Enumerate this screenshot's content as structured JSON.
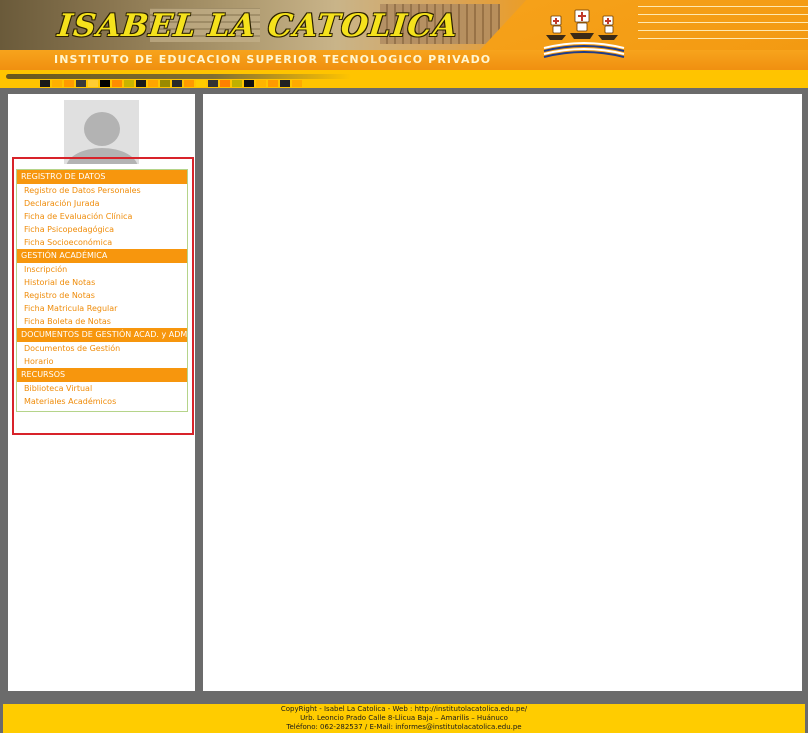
{
  "header": {
    "title": "ISABEL LA CATOLICA",
    "subtitle": "INSTITUTO DE EDUCACION SUPERIOR TECNOLOGICO PRIVADO",
    "colors": {
      "orange": "#f39a12",
      "yellow": "#ffc400",
      "title_yellow": "#f5e21c"
    },
    "color_strip": [
      "#1a1a1a",
      "#ffb000",
      "#ff9a00",
      "#3a3a3a",
      "#ffcc33",
      "#000000",
      "#ff8c00",
      "#c8b400",
      "#1a1a1a",
      "#ffa500",
      "#9a8a00",
      "#2a2a2a",
      "#ff9900",
      "#ffcc00",
      "#333333",
      "#ff8000",
      "#c0b000",
      "#111111",
      "#ffb400",
      "#ff9a00",
      "#222222",
      "#ffaa00"
    ]
  },
  "sidebar": {
    "avatar_icon": "user-avatar-icon",
    "menu": [
      {
        "section": "REGISTRO DE DATOS",
        "items": [
          "Registro de Datos Personales",
          "Declaración Jurada",
          "Ficha de Evaluación Clínica",
          "Ficha Psicopedagógica",
          "Ficha Socioeconómica"
        ]
      },
      {
        "section": "GESTIÓN ACADÉMICA",
        "items": [
          "Inscripción",
          "Historial de Notas",
          "Registro de Notas",
          "Ficha Matricula Regular",
          "Ficha Boleta de Notas"
        ]
      },
      {
        "section": "DOCUMENTOS DE GESTIÓN ACAD. y ADM.",
        "items": [
          "Documentos de Gestión",
          "Horario"
        ]
      },
      {
        "section": "RECURSOS",
        "items": [
          "Biblioteca Virtual",
          "Materiales Académicos"
        ]
      }
    ],
    "accent_color": "#f7960d",
    "highlight_color": "#d8232a"
  },
  "footer": {
    "line1": "CopyRight - Isabel La Catolica - Web : http://institutolacatolica.edu.pe/",
    "line2": "Urb. Leoncio Prado Calle 8-Llicua Baja – Amarilis – Huánuco",
    "line3": "Teléfono: 062-282537 / E-Mail: informes@institutolacatolica.edu.pe",
    "background": "#ffcc00"
  }
}
